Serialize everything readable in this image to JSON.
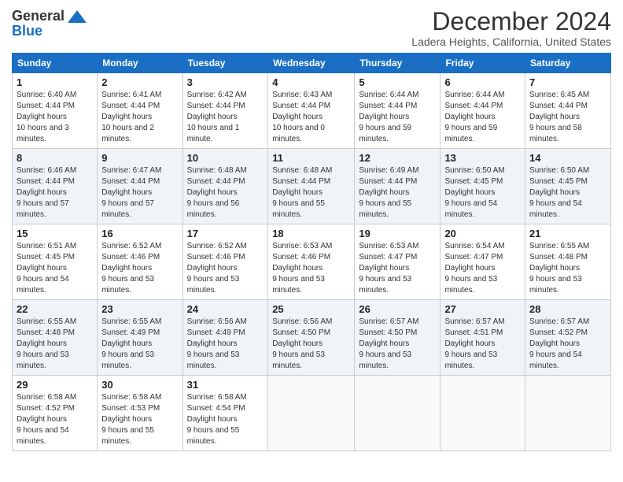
{
  "header": {
    "logo_line1": "General",
    "logo_line2": "Blue",
    "main_title": "December 2024",
    "subtitle": "Ladera Heights, California, United States"
  },
  "days_of_week": [
    "Sunday",
    "Monday",
    "Tuesday",
    "Wednesday",
    "Thursday",
    "Friday",
    "Saturday"
  ],
  "weeks": [
    [
      {
        "day": "1",
        "sunrise": "6:40 AM",
        "sunset": "4:44 PM",
        "daylight": "10 hours and 3 minutes."
      },
      {
        "day": "2",
        "sunrise": "6:41 AM",
        "sunset": "4:44 PM",
        "daylight": "10 hours and 2 minutes."
      },
      {
        "day": "3",
        "sunrise": "6:42 AM",
        "sunset": "4:44 PM",
        "daylight": "10 hours and 1 minute."
      },
      {
        "day": "4",
        "sunrise": "6:43 AM",
        "sunset": "4:44 PM",
        "daylight": "10 hours and 0 minutes."
      },
      {
        "day": "5",
        "sunrise": "6:44 AM",
        "sunset": "4:44 PM",
        "daylight": "9 hours and 59 minutes."
      },
      {
        "day": "6",
        "sunrise": "6:44 AM",
        "sunset": "4:44 PM",
        "daylight": "9 hours and 59 minutes."
      },
      {
        "day": "7",
        "sunrise": "6:45 AM",
        "sunset": "4:44 PM",
        "daylight": "9 hours and 58 minutes."
      }
    ],
    [
      {
        "day": "8",
        "sunrise": "6:46 AM",
        "sunset": "4:44 PM",
        "daylight": "9 hours and 57 minutes."
      },
      {
        "day": "9",
        "sunrise": "6:47 AM",
        "sunset": "4:44 PM",
        "daylight": "9 hours and 57 minutes."
      },
      {
        "day": "10",
        "sunrise": "6:48 AM",
        "sunset": "4:44 PM",
        "daylight": "9 hours and 56 minutes."
      },
      {
        "day": "11",
        "sunrise": "6:48 AM",
        "sunset": "4:44 PM",
        "daylight": "9 hours and 55 minutes."
      },
      {
        "day": "12",
        "sunrise": "6:49 AM",
        "sunset": "4:44 PM",
        "daylight": "9 hours and 55 minutes."
      },
      {
        "day": "13",
        "sunrise": "6:50 AM",
        "sunset": "4:45 PM",
        "daylight": "9 hours and 54 minutes."
      },
      {
        "day": "14",
        "sunrise": "6:50 AM",
        "sunset": "4:45 PM",
        "daylight": "9 hours and 54 minutes."
      }
    ],
    [
      {
        "day": "15",
        "sunrise": "6:51 AM",
        "sunset": "4:45 PM",
        "daylight": "9 hours and 54 minutes."
      },
      {
        "day": "16",
        "sunrise": "6:52 AM",
        "sunset": "4:46 PM",
        "daylight": "9 hours and 53 minutes."
      },
      {
        "day": "17",
        "sunrise": "6:52 AM",
        "sunset": "4:46 PM",
        "daylight": "9 hours and 53 minutes."
      },
      {
        "day": "18",
        "sunrise": "6:53 AM",
        "sunset": "4:46 PM",
        "daylight": "9 hours and 53 minutes."
      },
      {
        "day": "19",
        "sunrise": "6:53 AM",
        "sunset": "4:47 PM",
        "daylight": "9 hours and 53 minutes."
      },
      {
        "day": "20",
        "sunrise": "6:54 AM",
        "sunset": "4:47 PM",
        "daylight": "9 hours and 53 minutes."
      },
      {
        "day": "21",
        "sunrise": "6:55 AM",
        "sunset": "4:48 PM",
        "daylight": "9 hours and 53 minutes."
      }
    ],
    [
      {
        "day": "22",
        "sunrise": "6:55 AM",
        "sunset": "4:48 PM",
        "daylight": "9 hours and 53 minutes."
      },
      {
        "day": "23",
        "sunrise": "6:55 AM",
        "sunset": "4:49 PM",
        "daylight": "9 hours and 53 minutes."
      },
      {
        "day": "24",
        "sunrise": "6:56 AM",
        "sunset": "4:49 PM",
        "daylight": "9 hours and 53 minutes."
      },
      {
        "day": "25",
        "sunrise": "6:56 AM",
        "sunset": "4:50 PM",
        "daylight": "9 hours and 53 minutes."
      },
      {
        "day": "26",
        "sunrise": "6:57 AM",
        "sunset": "4:50 PM",
        "daylight": "9 hours and 53 minutes."
      },
      {
        "day": "27",
        "sunrise": "6:57 AM",
        "sunset": "4:51 PM",
        "daylight": "9 hours and 53 minutes."
      },
      {
        "day": "28",
        "sunrise": "6:57 AM",
        "sunset": "4:52 PM",
        "daylight": "9 hours and 54 minutes."
      }
    ],
    [
      {
        "day": "29",
        "sunrise": "6:58 AM",
        "sunset": "4:52 PM",
        "daylight": "9 hours and 54 minutes."
      },
      {
        "day": "30",
        "sunrise": "6:58 AM",
        "sunset": "4:53 PM",
        "daylight": "9 hours and 55 minutes."
      },
      {
        "day": "31",
        "sunrise": "6:58 AM",
        "sunset": "4:54 PM",
        "daylight": "9 hours and 55 minutes."
      },
      null,
      null,
      null,
      null
    ]
  ]
}
